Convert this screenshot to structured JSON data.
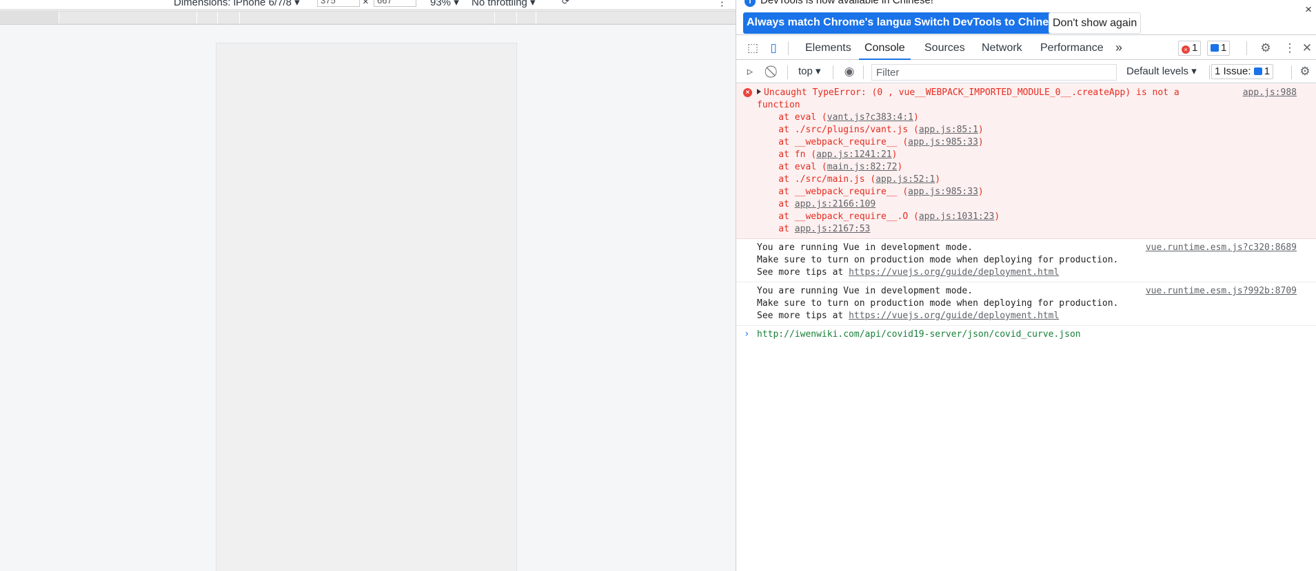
{
  "device_toolbar": {
    "dimensions_label": "Dimensions: iPhone 6/7/8 ▾",
    "width_value": "375",
    "height_value": "667",
    "zoom": "93% ▾",
    "throttling": "No throttling ▾"
  },
  "infobar": {
    "text": "DevTools is now available in Chinese!",
    "buttons": [
      "Always match Chrome's language",
      "Switch DevTools to Chinese",
      "Don't show again"
    ],
    "close": "×"
  },
  "tabs": [
    "Elements",
    "Console",
    "Sources",
    "Network",
    "Performance"
  ],
  "active_tab": "Console",
  "more_tabs": "»",
  "badges": {
    "errors": "1",
    "messages": "1"
  },
  "console_toolbar": {
    "context": "top",
    "filter_placeholder": "Filter",
    "levels": "Default levels ▾",
    "issues_label": "1 Issue:",
    "issues_count": "1"
  },
  "console": {
    "error": {
      "line1": "Uncaught TypeError: (0 , vue__WEBPACK_IMPORTED_MODULE_0__.createApp) is not a",
      "line2": "function",
      "source": "app.js:988",
      "stack": [
        {
          "prefix": "    at eval (",
          "link": "vant.js?c383:4:1",
          "suffix": ")"
        },
        {
          "prefix": "    at ./src/plugins/vant.js (",
          "link": "app.js:85:1",
          "suffix": ")"
        },
        {
          "prefix": "    at __webpack_require__ (",
          "link": "app.js:985:33",
          "suffix": ")"
        },
        {
          "prefix": "    at fn (",
          "link": "app.js:1241:21",
          "suffix": ")"
        },
        {
          "prefix": "    at eval (",
          "link": "main.js:82:72",
          "suffix": ")"
        },
        {
          "prefix": "    at ./src/main.js (",
          "link": "app.js:52:1",
          "suffix": ")"
        },
        {
          "prefix": "    at __webpack_require__ (",
          "link": "app.js:985:33",
          "suffix": ")"
        },
        {
          "prefix": "    at ",
          "link": "app.js:2166:109",
          "suffix": ""
        },
        {
          "prefix": "    at __webpack_require__.O (",
          "link": "app.js:1031:23",
          "suffix": ")"
        },
        {
          "prefix": "    at ",
          "link": "app.js:2167:53",
          "suffix": ""
        }
      ]
    },
    "logs": [
      {
        "line1": "You are running Vue in development mode.",
        "line2": "Make sure to turn on production mode when deploying for production.",
        "line3_prefix": "See more tips at ",
        "line3_link": "https://vuejs.org/guide/deployment.html",
        "source": "vue.runtime.esm.js?c320:8689"
      },
      {
        "line1": "You are running Vue in development mode.",
        "line2": "Make sure to turn on production mode when deploying for production.",
        "line3_prefix": "See more tips at ",
        "line3_link": "https://vuejs.org/guide/deployment.html",
        "source": "vue.runtime.esm.js?992b:8709"
      }
    ],
    "prompt_value": "http://iwenwiki.com/api/covid19-server/json/covid_curve.json"
  },
  "colors": {
    "accent": "#1a73e8",
    "error": "#e32d20",
    "error_bg": "#fdf0f0"
  }
}
